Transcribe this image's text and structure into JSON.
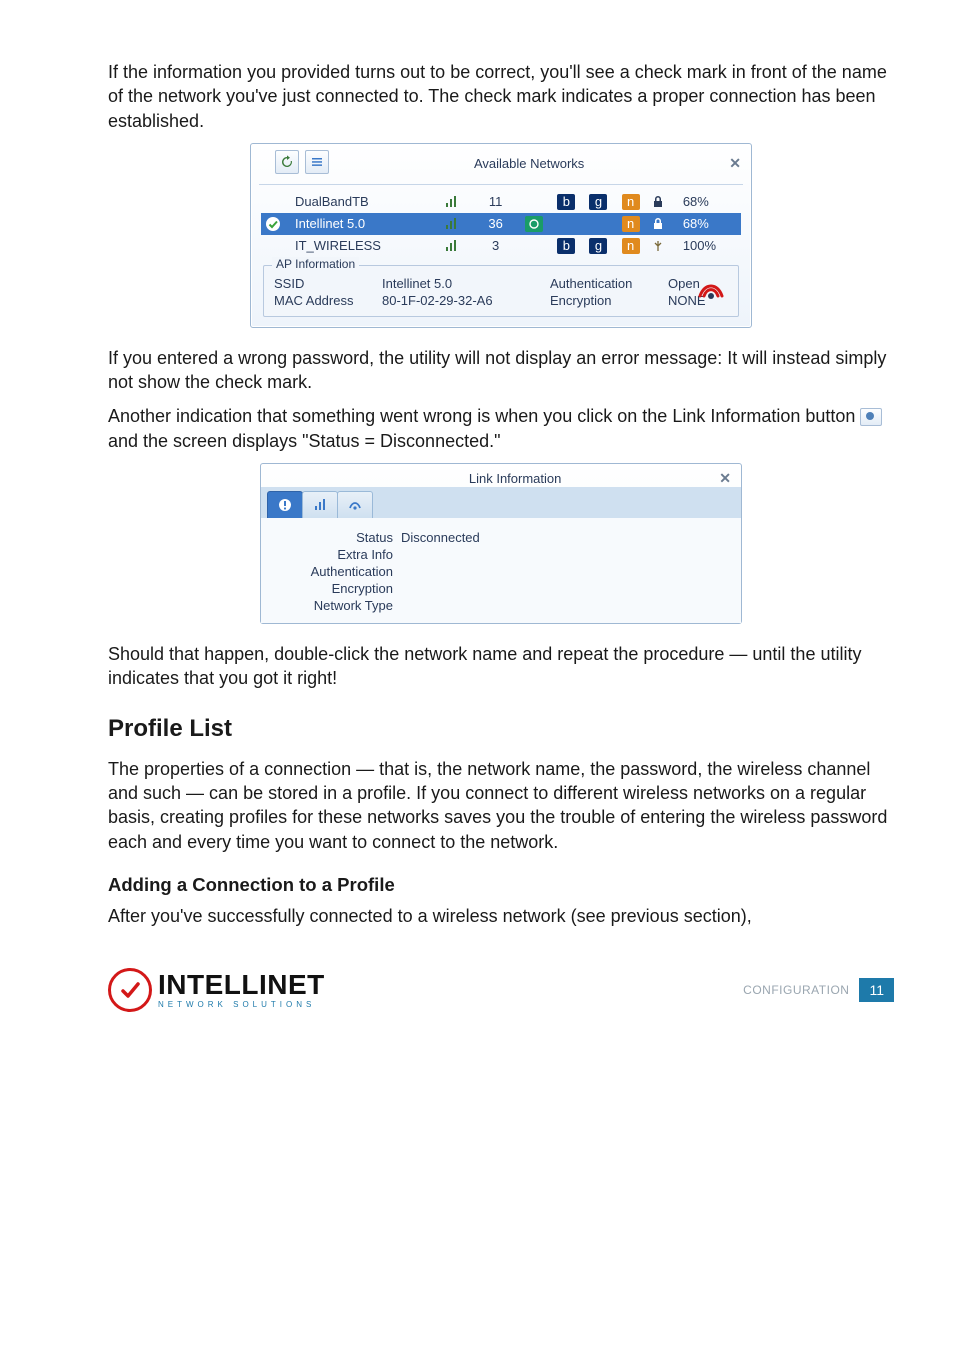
{
  "para1": "If the information you provided turns out to be correct, you'll see a check mark in front of the name of the network you've just connected to. The check mark indicates a proper connection has been established.",
  "para2": "If you entered a wrong password, the utility will not display an error message: It will instead simply not show the check mark.",
  "para3a": "Another indication that something went wrong is when you click on the Link Information button ",
  "para3b": " and the screen displays \"Status = Disconnected.\"",
  "para4": "Should that happen, double-click the network name and repeat the procedure — until the utility indicates that you got it right!",
  "heading_profile": "Profile List",
  "para5": "The properties of a connection — that is, the network name, the password, the wireless channel and such — can be stored in a profile. If you connect to different wireless networks on a regular basis, creating profiles for these networks saves you the trouble of entering the wireless password each and every time you want to connect to the network.",
  "heading_adding": "Adding a Connection to a Profile",
  "para6": "After you've successfully connected to a wireless network (see previous section),",
  "avail": {
    "title": "Available Networks",
    "networks": [
      {
        "name": "DualBandTB",
        "ch": "11",
        "pct": "68%",
        "selected": false,
        "checked": false
      },
      {
        "name": "Intellinet 5.0",
        "ch": "36",
        "pct": "68%",
        "selected": true,
        "checked": true
      },
      {
        "name": "IT_WIRELESS",
        "ch": "3",
        "pct": "100%",
        "selected": false,
        "checked": false
      }
    ],
    "ap": {
      "legend": "AP Information",
      "ssid_label": "SSID",
      "ssid_value": "Intellinet 5.0",
      "auth_label": "Authentication",
      "auth_value": "Open",
      "mac_label": "MAC Address",
      "mac_value": "80-1F-02-29-32-A6",
      "enc_label": "Encryption",
      "enc_value": "NONE"
    }
  },
  "linkinfo": {
    "title": "Link Information",
    "rows": [
      {
        "k": "Status",
        "v": "Disconnected"
      },
      {
        "k": "Extra Info",
        "v": ""
      },
      {
        "k": "Authentication",
        "v": ""
      },
      {
        "k": "Encryption",
        "v": ""
      },
      {
        "k": "Network Type",
        "v": ""
      }
    ]
  },
  "footer": {
    "brand": "INTELLINET",
    "brand_sub": "NETWORK SOLUTIONS",
    "section": "CONFIGURATION",
    "page": "11"
  }
}
